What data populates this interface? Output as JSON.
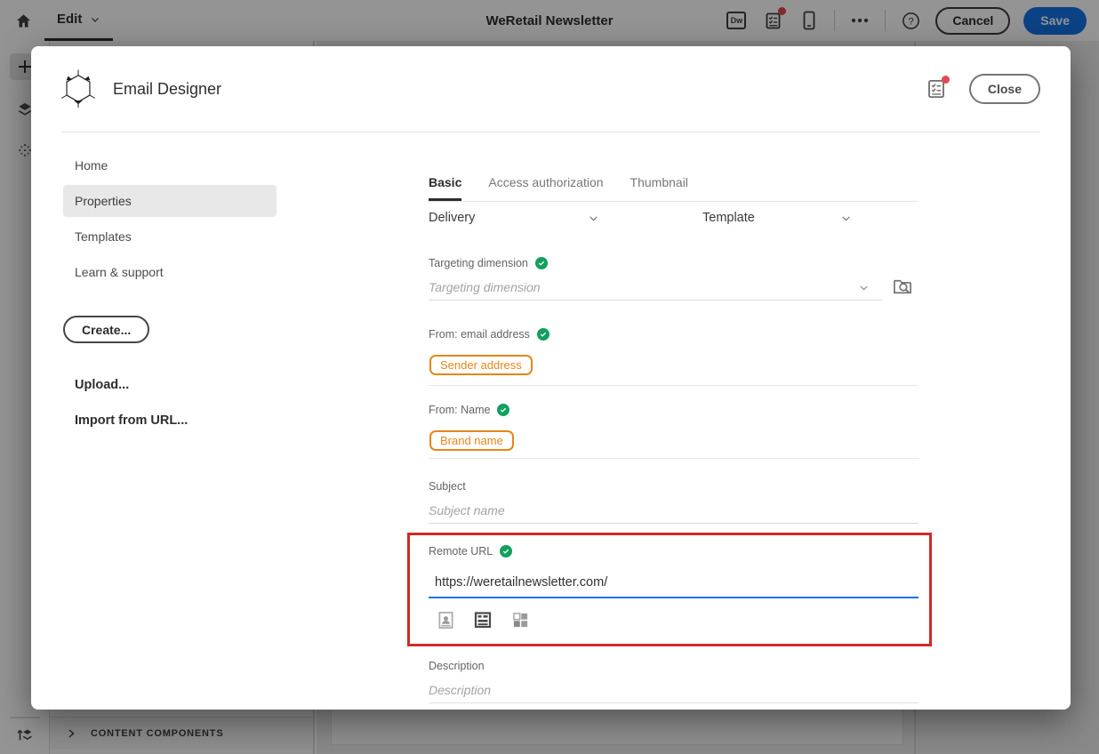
{
  "colors": {
    "accent_blue": "#1473e6",
    "positive_green": "#12a05e",
    "chip_orange": "#e68619",
    "highlight_red": "#d02a24",
    "badge_red": "#e34850"
  },
  "topbar": {
    "edit_label": "Edit",
    "title": "WeRetail Newsletter",
    "dw_label": "Dw",
    "cancel_label": "Cancel",
    "save_label": "Save"
  },
  "bottom_panel": {
    "header_label": "CONTENT COMPONENTS"
  },
  "modal": {
    "title": "Email Designer",
    "close_label": "Close",
    "nav": {
      "items": [
        {
          "label": "Home",
          "selected": false
        },
        {
          "label": "Properties",
          "selected": true
        },
        {
          "label": "Templates",
          "selected": false
        },
        {
          "label": "Learn & support",
          "selected": false
        }
      ],
      "create_label": "Create...",
      "upload_label": "Upload...",
      "import_label": "Import from URL..."
    },
    "tabs": [
      {
        "label": "Basic",
        "active": true
      },
      {
        "label": "Access authorization",
        "active": false
      },
      {
        "label": "Thumbnail",
        "active": false
      }
    ],
    "selects": {
      "delivery_label": "Delivery",
      "template_label": "Template"
    },
    "fields": {
      "targeting": {
        "label": "Targeting dimension",
        "placeholder": "Targeting dimension",
        "validated": true
      },
      "from_email": {
        "label": "From: email address",
        "chip": "Sender address",
        "validated": true
      },
      "from_name": {
        "label": "From: Name",
        "chip": "Brand name",
        "validated": true
      },
      "subject": {
        "label": "Subject",
        "placeholder": "Subject name"
      },
      "remote_url": {
        "label": "Remote URL",
        "value": "https://weretailnewsletter.com/",
        "validated": true
      },
      "description": {
        "label": "Description",
        "placeholder": "Description"
      }
    }
  }
}
